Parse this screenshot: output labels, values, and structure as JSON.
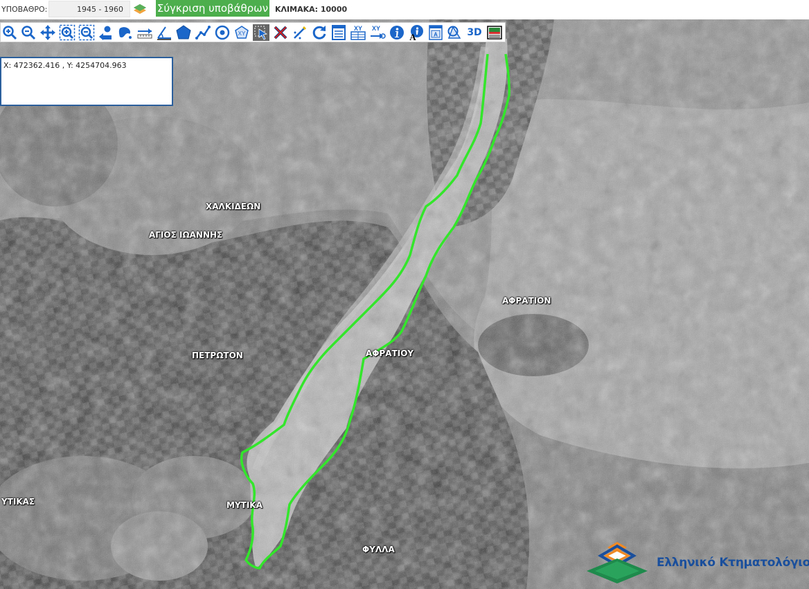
{
  "topbar": {
    "basemap_label": "ΥΠΟΒΑΘΡΟ:",
    "period": "1945 - 1960",
    "compare_button": "Σύγκριση υποβάθρων",
    "scale_label": "ΚΛΙΜΑΚΑ: 10000"
  },
  "toolbar": {
    "tools": [
      {
        "icon": "zoom-in-icon"
      },
      {
        "icon": "zoom-out-icon"
      },
      {
        "icon": "pan-icon"
      },
      {
        "icon": "zoom-box-in-icon"
      },
      {
        "icon": "zoom-box-out-icon"
      },
      {
        "icon": "previous-extent-icon"
      },
      {
        "icon": "full-extent-icon"
      },
      {
        "icon": "measure-distance-icon"
      },
      {
        "icon": "measure-angle-icon"
      },
      {
        "icon": "measure-area-icon"
      },
      {
        "icon": "draw-polyline-icon"
      },
      {
        "icon": "draw-point-icon"
      },
      {
        "icon": "draw-polygon-xy-icon"
      },
      {
        "icon": "select-icon"
      },
      {
        "icon": "clear-icon"
      },
      {
        "icon": "edit-icon"
      },
      {
        "icon": "refresh-icon"
      },
      {
        "icon": "legend-icon"
      },
      {
        "icon": "xy-table-icon"
      },
      {
        "icon": "xy-goto-icon"
      },
      {
        "icon": "info-icon"
      },
      {
        "icon": "info-label-icon"
      },
      {
        "icon": "print-icon"
      },
      {
        "icon": "street-view-icon"
      },
      {
        "icon": "3d-view-icon",
        "label": "3D"
      },
      {
        "icon": "export-image-icon"
      }
    ],
    "accent_color": "#1b66c9"
  },
  "coordinates": {
    "text": "X: 472362.416 , Y: 4254704.963"
  },
  "map": {
    "labels": {
      "chalkideon": "ΧΑΛΚΙΔΕΩΝ",
      "agios_ioannis": "ΑΓΙΟΣ ΙΩΑΝΝΗΣ",
      "petroton": "ΠΕΤΡΩΤΟΝ",
      "afratiou": "ΑΦΡΑΤΙΟΥ",
      "afration": "ΑΦΡΑΤΙΟΝ",
      "ytikas": "ΥΤΙΚΑΣ",
      "mytika": "ΜΥΤΙΚΑ",
      "fylla": "ΦΥΛΛΑ"
    },
    "boundary_color": "#33e62b"
  },
  "logo": {
    "text": "Ελληνικό Κτηματολόγιο",
    "colors": {
      "orange": "#f08a24",
      "green": "#1f8a4c",
      "blue": "#1a4f9c"
    }
  }
}
